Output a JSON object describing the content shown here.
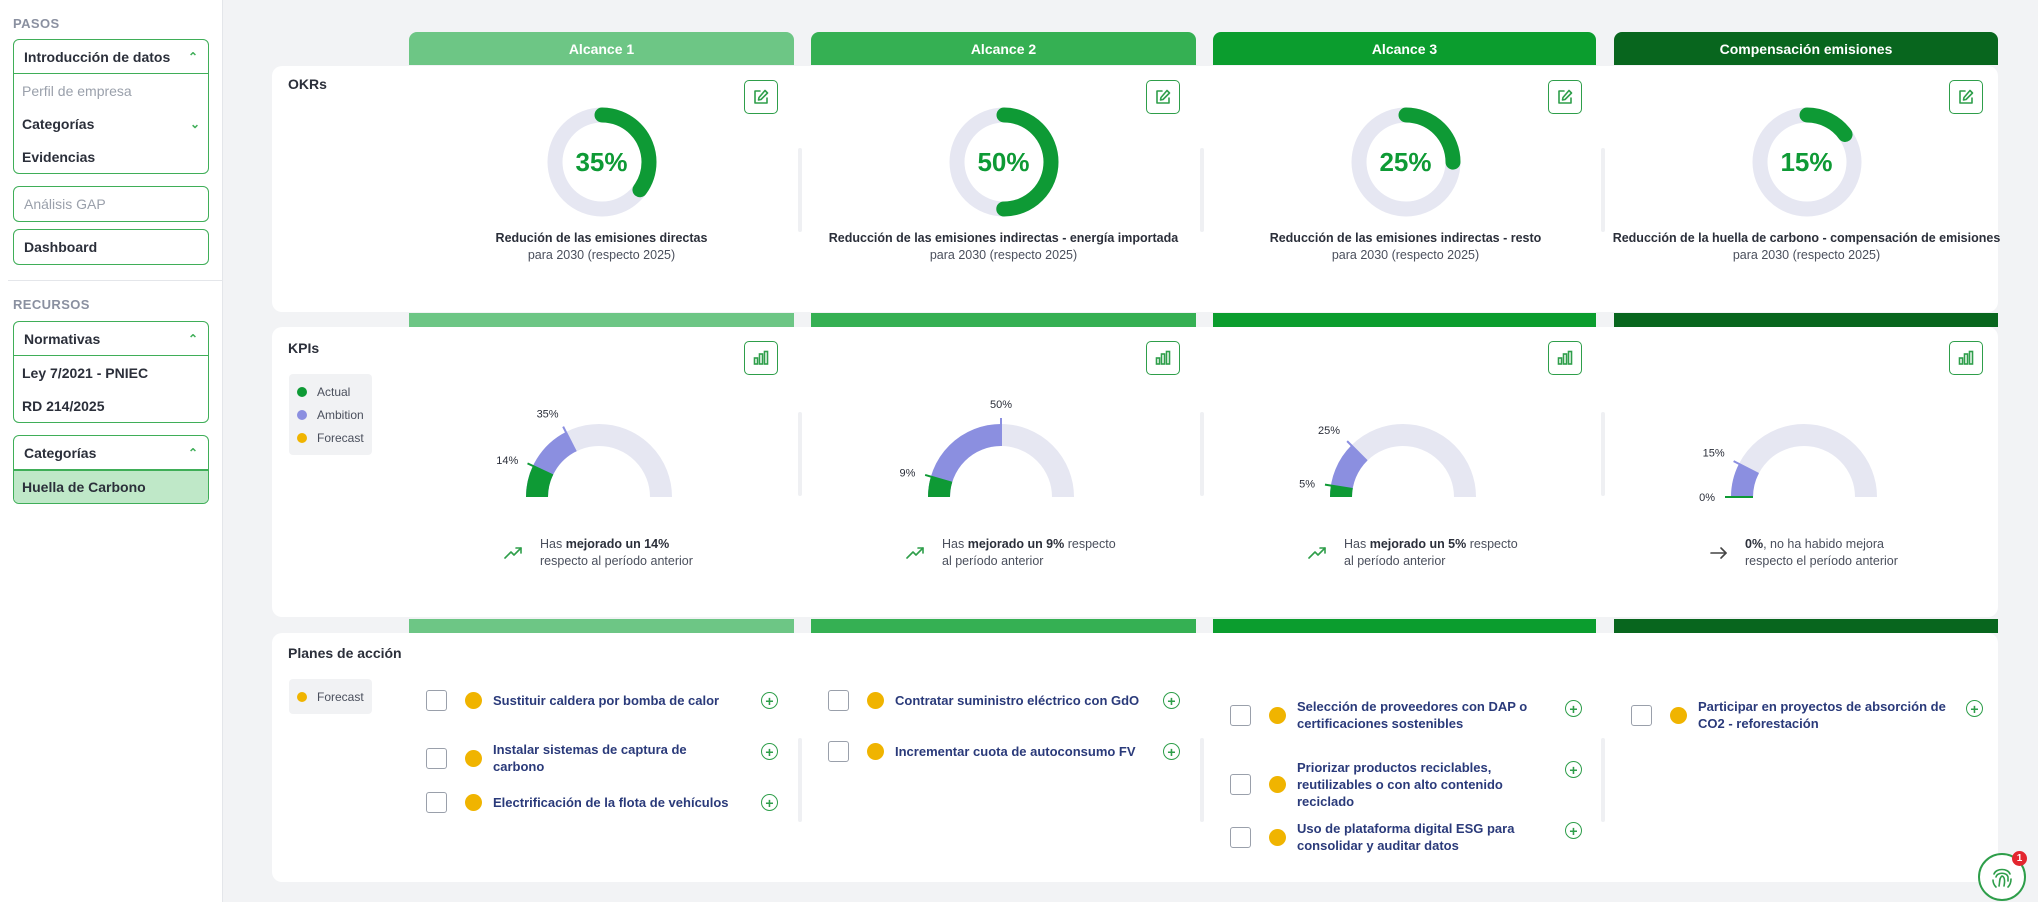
{
  "sidebar": {
    "pasos_title": "PASOS",
    "intro": {
      "label": "Introducción de datos"
    },
    "intro_items": [
      {
        "label": "Perfil de empresa"
      },
      {
        "label": "Categorías"
      },
      {
        "label": "Evidencias"
      }
    ],
    "gap": "Análisis GAP",
    "dashboard": "Dashboard",
    "recursos_title": "RECURSOS",
    "normativas": {
      "label": "Normativas"
    },
    "normativas_items": [
      {
        "label": "Ley 7/2021 - PNIEC"
      },
      {
        "label": "RD 214/2025"
      }
    ],
    "categorias": {
      "label": "Categorías"
    },
    "categorias_items": [
      {
        "label": "Huella de Carbono"
      }
    ]
  },
  "sections": {
    "okrs": "OKRs",
    "kpis": "KPIs",
    "planes": "Planes de acción"
  },
  "legend": {
    "actual": "Actual",
    "ambition": "Ambition",
    "forecast": "Forecast"
  },
  "colors": {
    "actual": "#0e9a35",
    "ambition": "#8b8fe0",
    "forecast": "#f0b400",
    "track": "#e6e7f2"
  },
  "columns": [
    {
      "header": "Alcance 1",
      "okr": {
        "percent": "35%",
        "value": 35,
        "title": "Redución de las emisiones directas",
        "sub": "para 2030 (respecto 2025)"
      },
      "kpi": {
        "actual": 14,
        "ambition": 35,
        "actual_label": "14%",
        "ambition_label": "35%",
        "note_pre": "Has ",
        "note_bold": "mejorado un 14%",
        "note_post": "",
        "note_line2": "respecto al período anterior",
        "trend": "up"
      },
      "plans": [
        {
          "text": "Sustituir caldera por bomba de calor"
        },
        {
          "text": "Instalar sistemas de captura de carbono"
        },
        {
          "text": "Electrificación de la flota de vehículos"
        }
      ]
    },
    {
      "header": "Alcance 2",
      "okr": {
        "percent": "50%",
        "value": 50,
        "title": "Reducción de las emisiones indirectas - energía importada",
        "sub": "para 2030 (respecto 2025)"
      },
      "kpi": {
        "actual": 9,
        "ambition": 50,
        "actual_label": "9%",
        "ambition_label": "50%",
        "note_pre": "Has ",
        "note_bold": "mejorado un 9%",
        "note_post": " respecto",
        "note_line2": "al período anterior",
        "trend": "up"
      },
      "plans": [
        {
          "text": "Contratar suministro eléctrico con GdO"
        },
        {
          "text": "Incrementar cuota de autoconsumo FV"
        }
      ]
    },
    {
      "header": "Alcance 3",
      "okr": {
        "percent": "25%",
        "value": 25,
        "title": "Reducción de las emisiones indirectas - resto",
        "sub": "para 2030 (respecto 2025)"
      },
      "kpi": {
        "actual": 5,
        "ambition": 25,
        "actual_label": "5%",
        "ambition_label": "25%",
        "note_pre": "Has ",
        "note_bold": "mejorado un 5%",
        "note_post": " respecto",
        "note_line2": "al período anterior",
        "trend": "up"
      },
      "plans": [
        {
          "text": "Selección de proveedores con DAP o certificaciones sostenibles"
        },
        {
          "text": "Priorizar productos reciclables, reutilizables o con alto contenido reciclado"
        },
        {
          "text": "Uso de plataforma digital ESG para consolidar y auditar datos"
        }
      ]
    },
    {
      "header": "Compensación emisiones",
      "okr": {
        "percent": "15%",
        "value": 15,
        "title": "Reducción de la huella de carbono - compensación de emisiones",
        "sub": "para 2030 (respecto 2025)"
      },
      "kpi": {
        "actual": 0,
        "ambition": 15,
        "actual_label": "0%",
        "ambition_label": "15%",
        "note_pre": "",
        "note_bold": "0%",
        "note_post": ", no ha habido mejora",
        "note_line2": "respecto el período anterior",
        "trend": "flat"
      },
      "plans": [
        {
          "text": "Participar en proyectos de absorción de CO2 - reforestación"
        }
      ]
    }
  ],
  "help": {
    "badge": "1"
  }
}
